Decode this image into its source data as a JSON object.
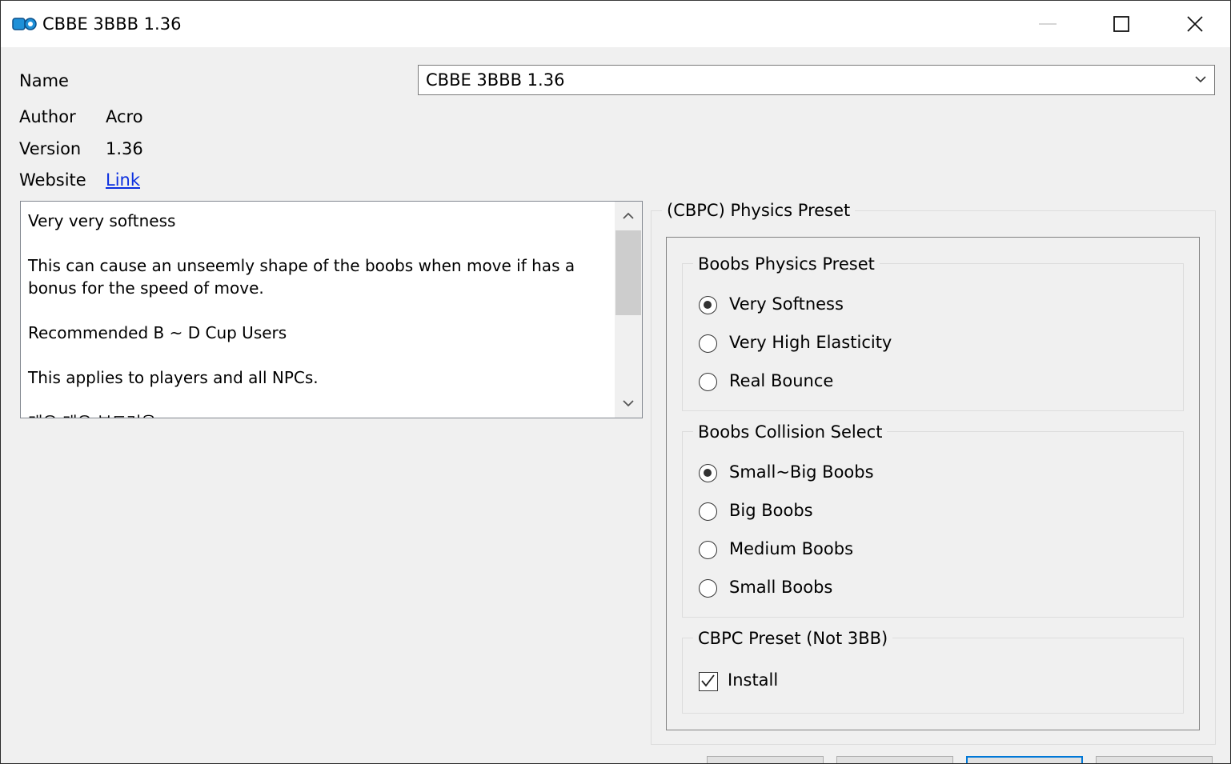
{
  "window": {
    "title": "CBBE 3BBB 1.36",
    "icon": "mod-organizer-icon",
    "controls": [
      "minimize-icon",
      "maximize-icon",
      "close-icon"
    ]
  },
  "info": {
    "name_label": "Name",
    "name_value": "CBBE 3BBB 1.36",
    "author_label": "Author",
    "author_value": "Acro",
    "version_label": "Version",
    "version_value": "1.36",
    "website_label": "Website",
    "website_link": "Link"
  },
  "description": "Very very softness\n\nThis can cause an unseemly shape of the boobs when move if has a\nbonus for the speed of move.\n\nRecommended B ~ D Cup Users\n\nThis applies to players and all NPCs.\n\n매우 매우 부드러움",
  "physics": {
    "title": "(CBPC) Physics Preset",
    "boobs_physics": {
      "title": "Boobs Physics Preset",
      "options": [
        {
          "label": "Very Softness",
          "checked": true
        },
        {
          "label": "Very High Elasticity",
          "checked": false
        },
        {
          "label": "Real Bounce",
          "checked": false
        }
      ]
    },
    "boobs_collision": {
      "title": "Boobs Collision Select",
      "options": [
        {
          "label": "Small~Big Boobs",
          "checked": true
        },
        {
          "label": "Big Boobs",
          "checked": false
        },
        {
          "label": "Medium Boobs",
          "checked": false
        },
        {
          "label": "Small Boobs",
          "checked": false
        }
      ]
    },
    "cbpc_preset": {
      "title": "CBPC Preset (Not 3BB)",
      "install_label": "Install",
      "install_checked": true
    }
  },
  "colors": {
    "background": "#f0f0f0",
    "link": "#0b2fe0",
    "default_button_border": "#0078d7"
  }
}
